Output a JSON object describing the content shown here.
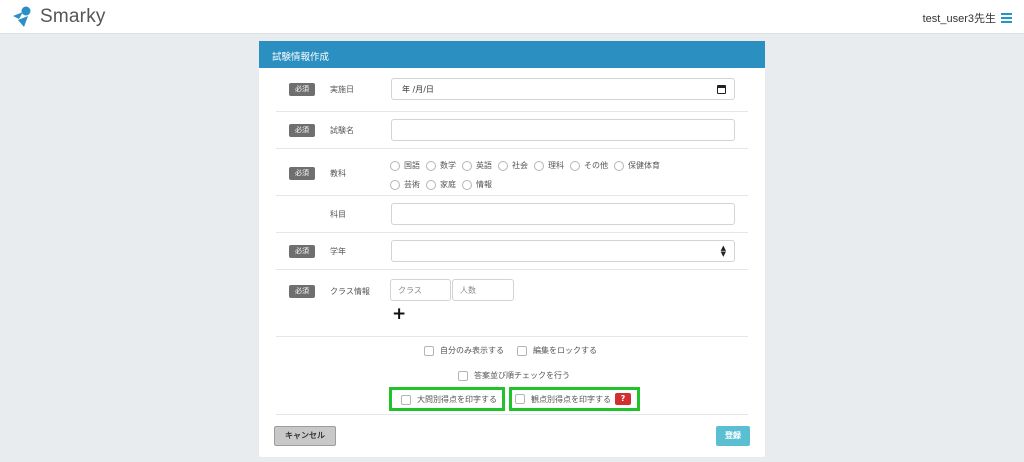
{
  "header": {
    "app_name": "Smarky",
    "user_label": "test_user3先生",
    "menu_icon": "hamburger-menu-icon"
  },
  "form": {
    "title": "試験情報作成",
    "required_badge": "必須",
    "fields": {
      "exam_date": {
        "label": "実施日",
        "value": "年 /月/日"
      },
      "exam_name": {
        "label": "試験名",
        "value": ""
      },
      "subject": {
        "label": "教科",
        "options": [
          "国語",
          "数学",
          "英語",
          "社会",
          "理科",
          "その他",
          "保健体育",
          "芸術",
          "家庭",
          "情報"
        ]
      },
      "course": {
        "label": "科目",
        "value": ""
      },
      "grade": {
        "label": "学年",
        "value": ""
      },
      "class_info": {
        "label": "クラス情報",
        "class_placeholder": "クラス",
        "count_placeholder": "人数",
        "add_symbol": "+"
      }
    },
    "checkboxes": {
      "only_me": "自分のみ表示する",
      "lock_edit": "編集をロックする",
      "answer_order_check": "答案並び順チェックを行う",
      "print_by_question": "大問別得点を印字する",
      "print_by_viewpoint": "観点別得点を印字する"
    },
    "help_label": "?",
    "buttons": {
      "cancel": "キャンセル",
      "submit": "登録"
    }
  },
  "colors": {
    "header_bar": "#2b8fc1",
    "submit": "#5bbfd3",
    "highlight": "#22c32a",
    "help": "#d23030"
  }
}
